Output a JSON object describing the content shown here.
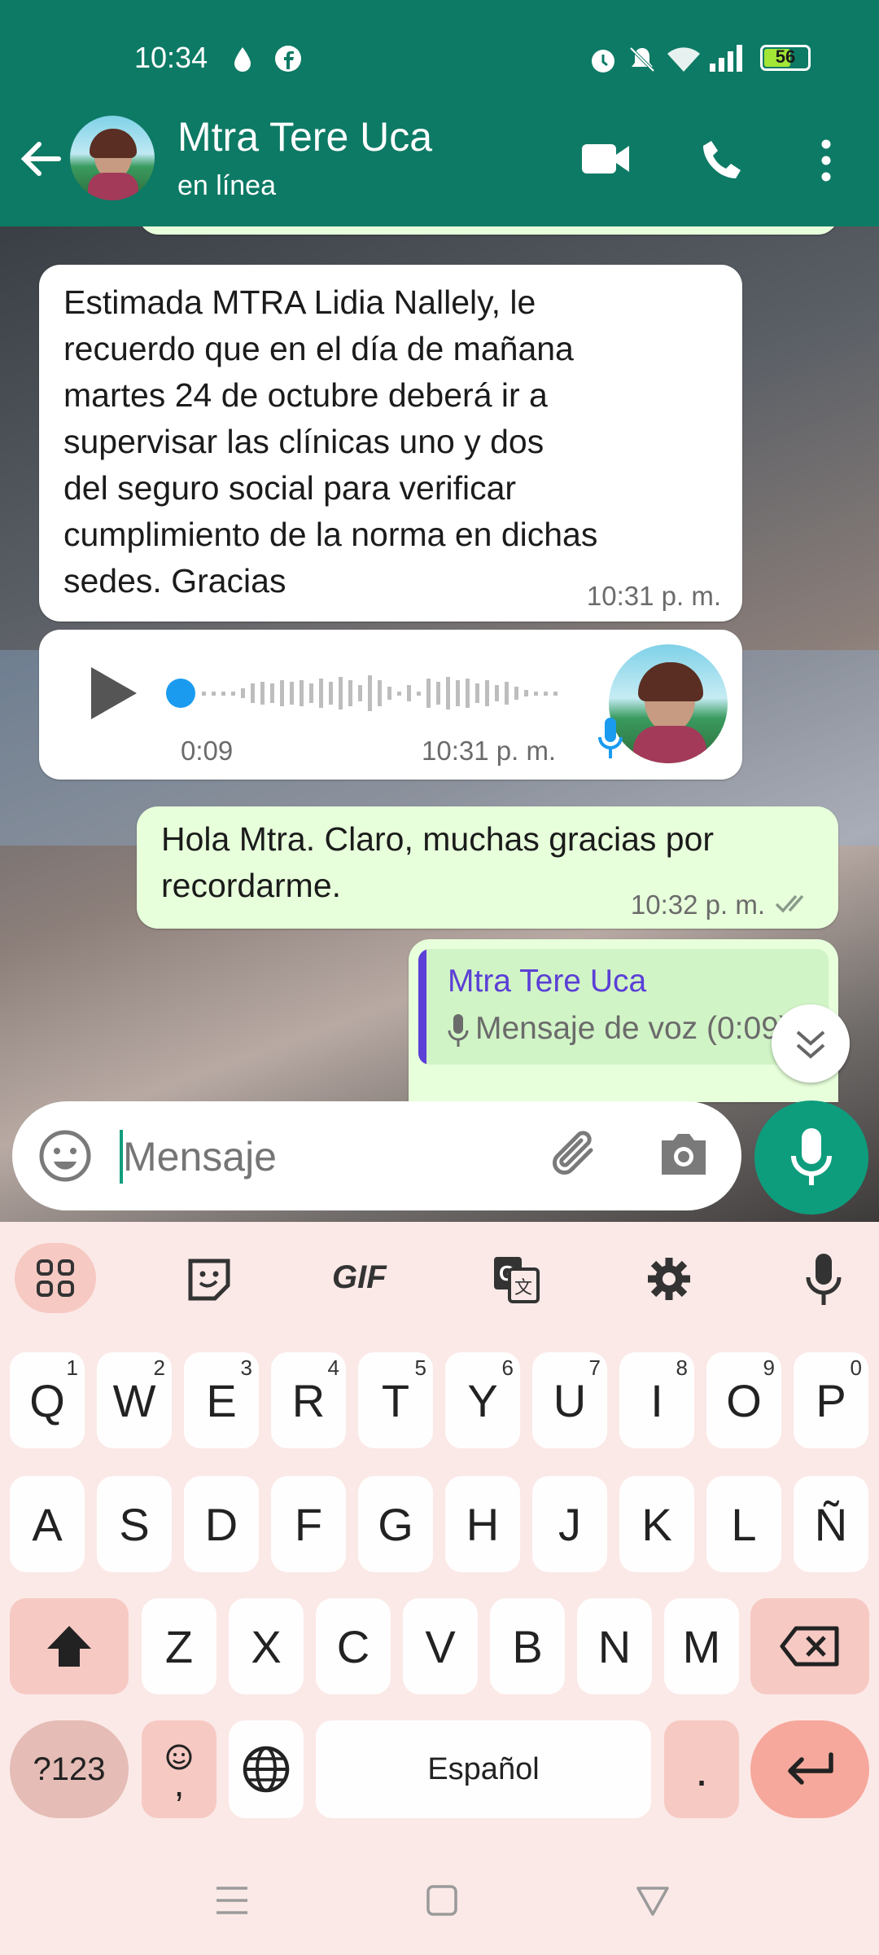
{
  "status_bar": {
    "time": "10:34",
    "battery": "56",
    "icons": [
      "droplet-icon",
      "facebook-icon",
      "alarm-icon",
      "mute-icon",
      "wifi-icon",
      "signal-icon",
      "battery-icon"
    ]
  },
  "header": {
    "contact_name": "Mtra Tere Uca",
    "status": "en línea",
    "icons": [
      "back-arrow-icon",
      "video-call-icon",
      "phone-icon",
      "more-vert-icon"
    ]
  },
  "messages": [
    {
      "type": "incoming-text",
      "lines": [
        "Estimada MTRA Lidia Nallely, le",
        "recuerdo que en el día de mañana",
        "martes 24 de octubre deberá ir a",
        "supervisar las clínicas uno y dos",
        "del seguro social para verificar",
        "cumplimiento de la norma en dichas",
        "sedes. Gracias"
      ],
      "time": "10:31 p. m."
    },
    {
      "type": "incoming-voice",
      "duration": "0:09",
      "time": "10:31 p. m."
    },
    {
      "type": "outgoing-text",
      "lines": [
        "Hola Mtra. Claro, muchas gracias por",
        "recordarme."
      ],
      "time": "10:32 p. m."
    },
    {
      "type": "outgoing-reply",
      "quoted_name": "Mtra Tere Uca",
      "quoted_text": "Mensaje de voz (0:09)"
    }
  ],
  "composer": {
    "placeholder": "Mensaje"
  },
  "keyboard": {
    "toolbar": [
      "apps-grid-icon",
      "sticker-icon",
      "GIF",
      "translate-icon",
      "settings-icon",
      "mic-icon"
    ],
    "gif_label": "GIF",
    "row1": [
      {
        "k": "Q",
        "h": "1"
      },
      {
        "k": "W",
        "h": "2"
      },
      {
        "k": "E",
        "h": "3"
      },
      {
        "k": "R",
        "h": "4"
      },
      {
        "k": "T",
        "h": "5"
      },
      {
        "k": "Y",
        "h": "6"
      },
      {
        "k": "U",
        "h": "7"
      },
      {
        "k": "I",
        "h": "8"
      },
      {
        "k": "O",
        "h": "9"
      },
      {
        "k": "P",
        "h": "0"
      }
    ],
    "row2": [
      "A",
      "S",
      "D",
      "F",
      "G",
      "H",
      "J",
      "K",
      "L",
      "Ñ"
    ],
    "row3": [
      "Z",
      "X",
      "C",
      "V",
      "B",
      "N",
      "M"
    ],
    "symbols_label": "?123",
    "emoji_comma": ",",
    "space_label": "Español",
    "period": "."
  }
}
